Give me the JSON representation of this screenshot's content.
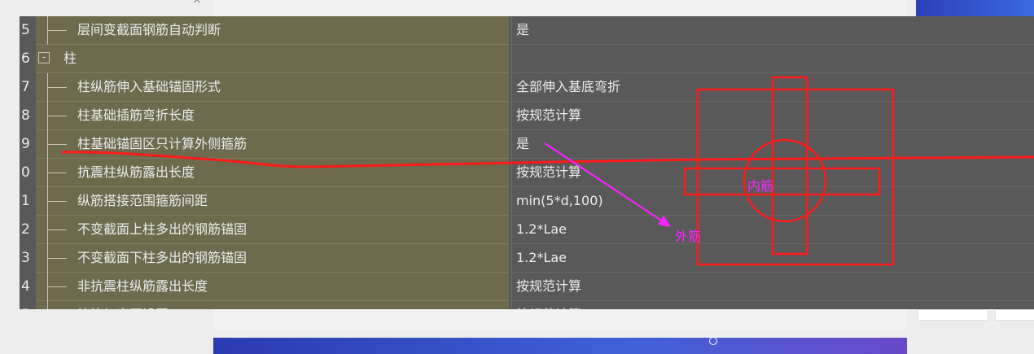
{
  "window": {
    "close_glyph": "×"
  },
  "rows": [
    {
      "num": "5",
      "label": "层间变截面钢筋自动判断",
      "value": "是",
      "group": false
    },
    {
      "num": "6",
      "label": "柱",
      "value": "",
      "group": true,
      "toggle": "-"
    },
    {
      "num": "7",
      "label": "柱纵筋伸入基础锚固形式",
      "value": "全部伸入基底弯折",
      "group": false
    },
    {
      "num": "8",
      "label": "柱基础插筋弯折长度",
      "value": "按规范计算",
      "group": false
    },
    {
      "num": "9",
      "label": "柱基础锚固区只计算外侧箍筋",
      "value": "是",
      "group": false
    },
    {
      "num": "0",
      "label": "抗震柱纵筋露出长度",
      "value": "按规范计算",
      "group": false
    },
    {
      "num": "1",
      "label": "纵筋搭接范围箍筋间距",
      "value": "min(5*d,100)",
      "group": false
    },
    {
      "num": "2",
      "label": "不变截面上柱多出的钢筋锚固",
      "value": "1.2*Lae",
      "group": false
    },
    {
      "num": "3",
      "label": "不变截面下柱多出的钢筋锚固",
      "value": "1.2*Lae",
      "group": false
    },
    {
      "num": "4",
      "label": "非抗震柱纵筋露出长度",
      "value": "按规范计算",
      "group": false
    },
    {
      "num": "5",
      "label": "箍筋加密区设置",
      "value": "按规范计算",
      "group": false
    }
  ],
  "annotations": {
    "inner_label": "内筋",
    "outer_label": "外筋",
    "red_color": "#ff1a1a",
    "magenta_color": "#ff22ff"
  },
  "colors": {
    "name_cell_bg": "#6d6a4e",
    "value_cell_bg": "#595959",
    "page_bg": "#ededed"
  }
}
